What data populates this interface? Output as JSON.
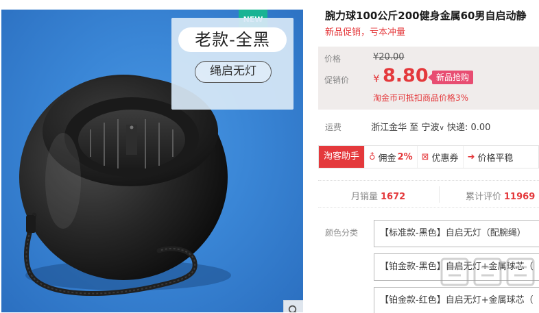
{
  "product_image": {
    "new_badge": "NEW",
    "tag_old": "老款-全黑",
    "tag_rope": "绳启无灯",
    "zoom_icon": "search-icon"
  },
  "product": {
    "title": "腕力球100公斤200健身金属60男自启动静",
    "subtitle": "新品促销，亏本冲量"
  },
  "price": {
    "orig_label": "价格",
    "orig_value": "¥20.00",
    "promo_label": "促销价",
    "currency": "¥",
    "promo_value": "8.80",
    "promo_tag": "新品抢购",
    "coin_note": "淘金币可抵扣商品价格3%"
  },
  "shipping": {
    "label": "运费",
    "from": "浙江金华",
    "to_word": "至",
    "to": "宁波",
    "express": "快递: 0.00"
  },
  "tools": {
    "main": "淘客助手",
    "commission_label": "佣金",
    "commission_value": "2%",
    "coupon": "优惠券",
    "price_trend": "价格平稳"
  },
  "stats": {
    "monthly_label": "月销量",
    "monthly_value": "1672",
    "reviews_label": "累计评价",
    "reviews_value": "11969"
  },
  "options": {
    "label": "颜色分类",
    "items": [
      "【标准款-黑色】自启无灯（配腕绳）",
      "【铂金款-黑色】自启无灯+金属球芯（",
      "【铂金款-红色】自启无灯+金属球芯（"
    ]
  },
  "colors": {
    "accent_red": "#e4393c",
    "badge_green": "#19b394",
    "promo_pink": "#e84d72",
    "image_blue": "#3a86d6"
  }
}
